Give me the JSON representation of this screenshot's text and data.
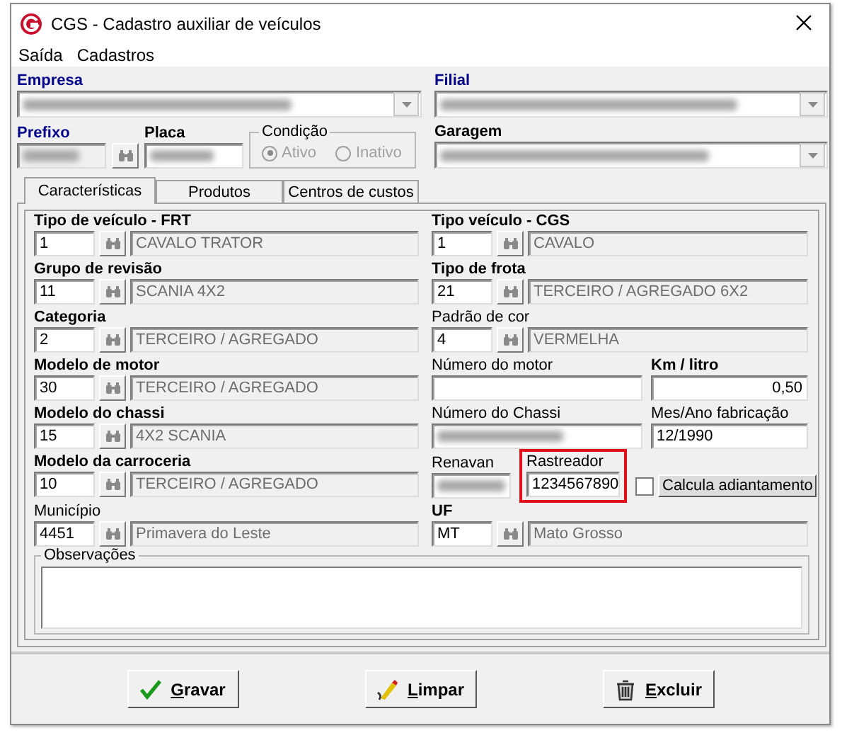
{
  "window": {
    "title": "CGS - Cadastro auxiliar de veículos"
  },
  "menu": [
    "Saída",
    "Cadastros"
  ],
  "header": {
    "empresa": {
      "label": "Empresa",
      "required": true,
      "label_bold": true,
      "redacted": true
    },
    "filial": {
      "label": "Filial",
      "required": true,
      "label_bold": true,
      "redacted": true
    },
    "prefixo": {
      "label": "Prefixo",
      "required": true,
      "label_bold": true,
      "redacted": true
    },
    "placa": {
      "label": "Placa",
      "required": false,
      "label_bold": true,
      "redacted": true
    },
    "condicao": {
      "label": "Condição",
      "disabled": true,
      "options": [
        {
          "label": "Ativo",
          "selected": true
        },
        {
          "label": "Inativo",
          "selected": false
        }
      ]
    },
    "garagem": {
      "label": "Garagem",
      "required": false,
      "label_bold": true,
      "redacted": true
    }
  },
  "tabs": [
    {
      "label": "Características",
      "selected": true
    },
    {
      "label": "Produtos",
      "selected": false
    },
    {
      "label": "Centros de custos",
      "selected": false
    }
  ],
  "rows": [
    {
      "left": {
        "kind": "lookup",
        "label": "Tipo de veículo - FRT",
        "label_bold": true,
        "code": "1",
        "description": "CAVALO TRATOR"
      },
      "right": [
        {
          "kind": "lookup",
          "label": "Tipo veículo - CGS",
          "label_bold": true,
          "code": "1",
          "description": "CAVALO"
        }
      ]
    },
    {
      "left": {
        "kind": "lookup",
        "label": "Grupo de revisão",
        "label_bold": true,
        "code": "11",
        "description": "SCANIA 4X2"
      },
      "right": [
        {
          "kind": "lookup",
          "label": "Tipo de frota",
          "label_bold": true,
          "code": "21",
          "description": "TERCEIRO / AGREGADO 6X2"
        }
      ]
    },
    {
      "left": {
        "kind": "lookup",
        "label": "Categoria",
        "label_bold": true,
        "code": "2",
        "description": "TERCEIRO / AGREGADO"
      },
      "right": [
        {
          "kind": "lookup",
          "label": "Padrão de cor",
          "label_bold": false,
          "code": "4",
          "description": "VERMELHA"
        }
      ]
    },
    {
      "left": {
        "kind": "lookup",
        "label": "Modelo de motor",
        "label_bold": true,
        "code": "30",
        "description": "TERCEIRO / AGREGADO"
      },
      "right": [
        {
          "kind": "text",
          "label": "Número do motor",
          "label_bold": false
        },
        {
          "kind": "text",
          "label": "Km / litro",
          "label_bold": true,
          "value": "0,50"
        }
      ]
    },
    {
      "left": {
        "kind": "lookup",
        "label": "Modelo do chassi",
        "label_bold": true,
        "code": "15",
        "description": "4X2 SCANIA"
      },
      "right": [
        {
          "kind": "text",
          "label": "Número do Chassi",
          "label_bold": false,
          "redacted": true
        },
        {
          "kind": "text",
          "label": "Mes/Ano fabricação",
          "label_bold": false,
          "value": "12/1990"
        }
      ]
    },
    {
      "left": {
        "kind": "lookup",
        "label": "Modelo da carroceria",
        "label_bold": true,
        "code": "10",
        "description": "TERCEIRO / AGREGADO"
      },
      "right": [
        {
          "kind": "text",
          "label": "Renavan",
          "label_bold": false,
          "redacted": true
        },
        {
          "kind": "text",
          "label": "Rastreador",
          "label_bold": false,
          "value": "1234567890",
          "highlighted": true
        },
        {
          "kind": "checkbutton",
          "label": "Calcula adiantamento",
          "checked": false
        }
      ]
    },
    {
      "left": {
        "kind": "lookup",
        "label": "Município",
        "label_bold": false,
        "code": "4451",
        "description": "Primavera do Leste"
      },
      "right": [
        {
          "kind": "lookup",
          "label": "UF",
          "label_bold": true,
          "code": "MT",
          "description": "Mato Grosso"
        }
      ]
    }
  ],
  "observacoes": {
    "label": "Observações"
  },
  "buttons": [
    {
      "kind": "save",
      "label": "Gravar"
    },
    {
      "kind": "clear",
      "label": "Limpar"
    },
    {
      "kind": "delete",
      "label": "Excluir"
    }
  ]
}
